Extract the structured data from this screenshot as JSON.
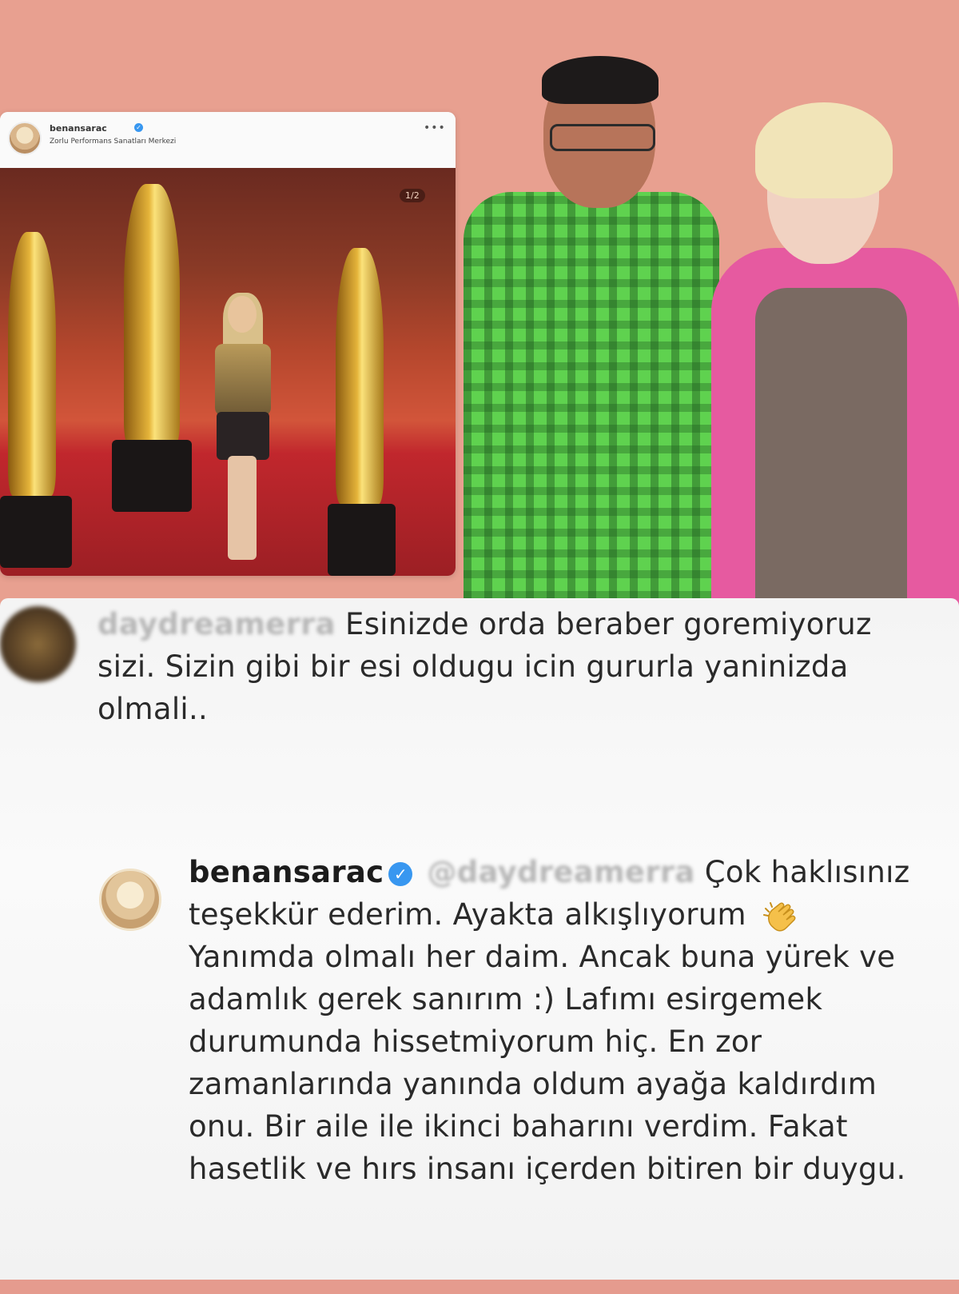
{
  "post_card": {
    "username": "benansarac",
    "location": "Zorlu Performans Sanatları Merkezi",
    "more_label": "•••",
    "counter": "1/2"
  },
  "comment_1": {
    "username": "daydreamerra",
    "text": "Esinizde orda beraber goremiyoruz sizi. Sizin gibi bir esi oldugu icin gururla yaninizda olmali.."
  },
  "comment_2": {
    "username": "benansarac",
    "mention": "@daydreamerra",
    "text_part1": "Çok haklısınız teşekkür ederim. Ayakta alkışlıyorum",
    "text_part2": "Yanımda olmalı her daim. Ancak buna yürek ve adamlık gerek sanırım :) Lafımı esirgemek durumunda hissetmiyorum hiç. En zor zamanlarında yanında oldum ayağa kaldırdım onu. Bir aile ile ikinci baharını verdim. Fakat hasetlik ve hırs insanı içerden bitiren bir duygu.",
    "emoji": "clapping-hands"
  },
  "colors": {
    "background": "#e59b8e",
    "verified": "#3897f0",
    "comment_bg": "#f7f7f7"
  }
}
